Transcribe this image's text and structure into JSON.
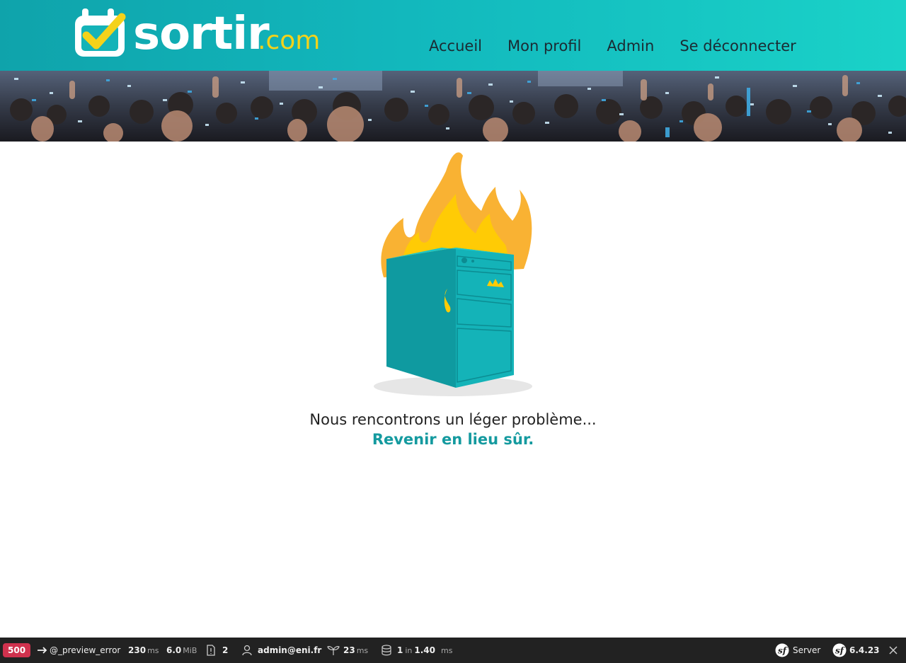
{
  "header": {
    "logo_main": "sortir",
    "logo_suffix": ".com",
    "nav": [
      {
        "label": "Accueil"
      },
      {
        "label": "Mon profil"
      },
      {
        "label": "Admin"
      },
      {
        "label": "Se déconnecter"
      }
    ]
  },
  "main": {
    "message": "Nous rencontrons un léger problème...",
    "link_label": "Revenir en lieu sûr."
  },
  "debug_toolbar": {
    "status_code": "500",
    "route": "@_preview_error",
    "time_value": "230",
    "time_unit": "ms",
    "memory_value": "6.0",
    "memory_unit": "MiB",
    "logs_count": "2",
    "user": "admin@eni.fr",
    "twig_value": "23",
    "twig_unit": "ms",
    "db_queries": "1",
    "db_in": "in",
    "db_time": "1.40",
    "db_unit": "ms",
    "server_label": "Server",
    "symfony_version": "6.4.23"
  },
  "colors": {
    "header_start": "#0fa3ab",
    "header_end": "#1ad2c8",
    "logo_accent": "#f4d21a",
    "link": "#149a9f",
    "status_badge": "#d0324e",
    "toolbar_bg": "#222222"
  }
}
